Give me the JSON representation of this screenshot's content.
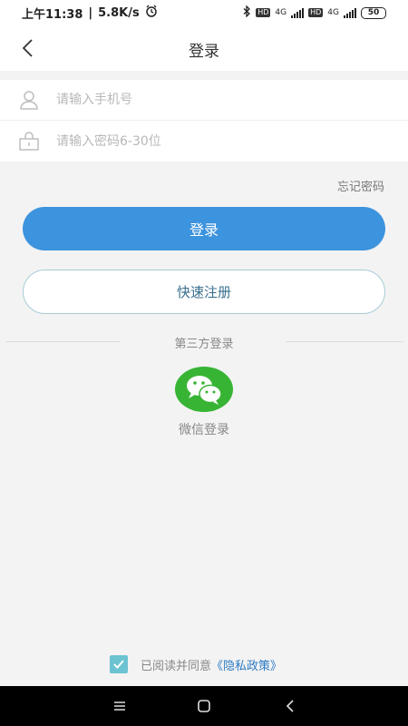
{
  "status_bar": {
    "time": "上午11:38",
    "speed": "5.8K/s",
    "network_left": "4G",
    "network_right": "4G",
    "battery": "50",
    "icons": [
      "alarm-icon",
      "bluetooth-icon",
      "hd-icon",
      "signal-icon",
      "battery-icon"
    ]
  },
  "header": {
    "title": "登录",
    "back_icon": "chevron-left-icon"
  },
  "form": {
    "phone_placeholder": "请输入手机号",
    "phone_icon": "user-icon",
    "password_placeholder": "请输入密码6-30位",
    "password_icon": "lock-icon"
  },
  "forgot_password": "忘记密码",
  "login_button": "登录",
  "register_button": "快速注册",
  "third_party": {
    "label": "第三方登录",
    "wechat_label": "微信登录",
    "wechat_icon": "wechat-icon"
  },
  "agreement": {
    "checked": true,
    "text": "已阅读并同意",
    "policy_link": "《隐私政策》"
  },
  "nav_bar": {
    "icons": [
      "menu-icon",
      "home-icon",
      "back-icon"
    ]
  },
  "colors": {
    "primary": "#3c93de",
    "wechat": "#38b435",
    "checkbox": "#6cc3d1",
    "link": "#2d7bc4"
  }
}
